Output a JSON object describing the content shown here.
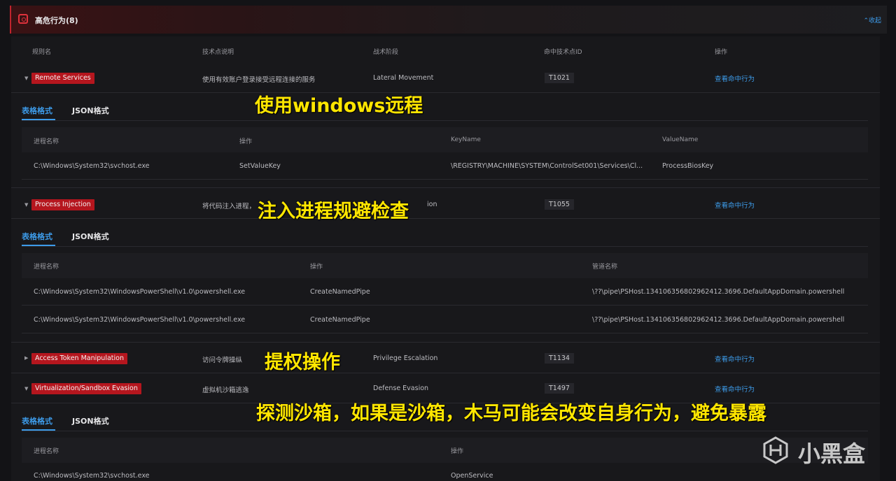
{
  "header": {
    "title": "高危行为(8)",
    "collapse_label": "⌃收起",
    "accent": "#c0242d"
  },
  "columns": {
    "rule": "规则名",
    "desc": "技术点说明",
    "tactic": "战术阶段",
    "tech_id": "命中技术点ID",
    "op": "操作"
  },
  "rules": [
    {
      "name": "Remote Services",
      "desc": "使用有效账户登录接受远程连接的服务",
      "tactic": "Lateral Movement",
      "id": "T1021",
      "action": "查看命中行为",
      "expanded": true
    },
    {
      "name": "Process Injection",
      "desc": "将代码注入进程，",
      "tactic": "ion",
      "id": "T1055",
      "action": "查看命中行为",
      "expanded": true
    },
    {
      "name": "Access Token Manipulation",
      "desc": "访问令牌操纵",
      "tactic": "Privilege Escalation",
      "id": "T1134",
      "action": "查看命中行为",
      "expanded": false
    },
    {
      "name": "Virtualization/Sandbox Evasion",
      "desc": "虚拟机沙箱逃逸",
      "tactic": "Defense Evasion",
      "id": "T1497",
      "action": "查看命中行为",
      "expanded": true
    }
  ],
  "tabs": {
    "table": "表格格式",
    "json": "JSON格式"
  },
  "detail1": {
    "headers": [
      "进程名称",
      "操作",
      "KeyName",
      "ValueName"
    ],
    "row": [
      "C:\\Windows\\System32\\svchost.exe",
      "SetValueKey",
      "\\REGISTRY\\MACHINE\\SYSTEM\\ControlSet001\\Services\\Cl...",
      "ProcessBiosKey"
    ]
  },
  "detail2": {
    "headers": [
      "进程名称",
      "操作",
      "管道名称"
    ],
    "rows": [
      [
        "C:\\Windows\\System32\\WindowsPowerShell\\v1.0\\powershell.exe",
        "CreateNamedPipe",
        "\\??\\pipe\\PSHost.134106356802962412.3696.DefaultAppDomain.powershell"
      ],
      [
        "C:\\Windows\\System32\\WindowsPowerShell\\v1.0\\powershell.exe",
        "CreateNamedPipe",
        "\\??\\pipe\\PSHost.134106356802962412.3696.DefaultAppDomain.powershell"
      ]
    ]
  },
  "detail3": {
    "headers": [
      "进程名称",
      "操作"
    ],
    "row": [
      "C:\\Windows\\System32\\svchost.exe",
      "OpenService"
    ]
  },
  "annotations": {
    "a1": "使用windows远程",
    "a2": "注入进程规避检查",
    "a3": "提权操作",
    "a4": "探测沙箱，如果是沙箱，木马可能会改变自身行为，避免暴露"
  },
  "watermark": {
    "text": "小黑盒"
  }
}
